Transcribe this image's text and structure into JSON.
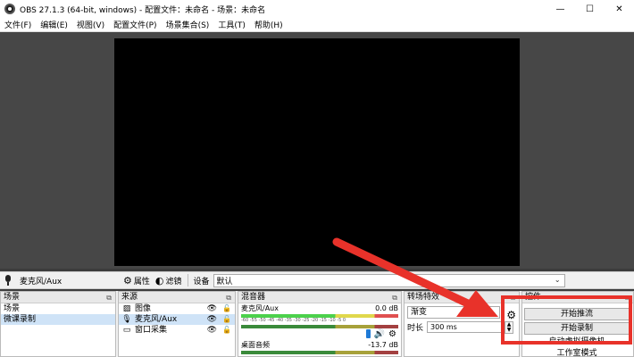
{
  "window": {
    "title": "OBS 27.1.3 (64-bit, windows) - 配置文件：未命名 - 场景：未命名",
    "minimize": "—",
    "maximize": "☐",
    "close": "✕"
  },
  "menu": [
    "文件(F)",
    "编辑(E)",
    "视图(V)",
    "配置文件(P)",
    "场景集合(S)",
    "工具(T)",
    "帮助(H)"
  ],
  "toolbar": {
    "source_name": "麦克风/Aux",
    "properties": "属性",
    "filters": "滤镜",
    "device_label": "设备",
    "device_value": "默认"
  },
  "scenes": {
    "title": "场景",
    "items": [
      "场景",
      "微课录制"
    ],
    "selected_index": 1
  },
  "sources": {
    "title": "来源",
    "items": [
      {
        "icon": "image-icon",
        "label": "图像"
      },
      {
        "icon": "microphone-icon",
        "label": "麦克风/Aux"
      },
      {
        "icon": "window-capture-icon",
        "label": "窗口采集"
      }
    ]
  },
  "mixer": {
    "title": "混音器",
    "channels": [
      {
        "name": "麦克风/Aux",
        "db": "0.0 dB"
      },
      {
        "name": "桌面音频",
        "db": "-13.7 dB"
      }
    ],
    "ticks": "-60 -55 -50 -45 -40 -35 -30 -25 -20 -15 -10 -5 0"
  },
  "transitions": {
    "title": "转场特效",
    "type": "渐变",
    "duration_label": "时长",
    "duration_value": "300 ms"
  },
  "controls": {
    "title": "控件",
    "start_stream": "开始推流",
    "start_record": "开始录制",
    "virtual_camera": "启动虚拟摄像机",
    "studio_mode": "工作室模式"
  },
  "colors": {
    "annotation_red": "#e8322a",
    "selection": "#cfe3f7",
    "volume_blue": "#1e7ad6"
  }
}
